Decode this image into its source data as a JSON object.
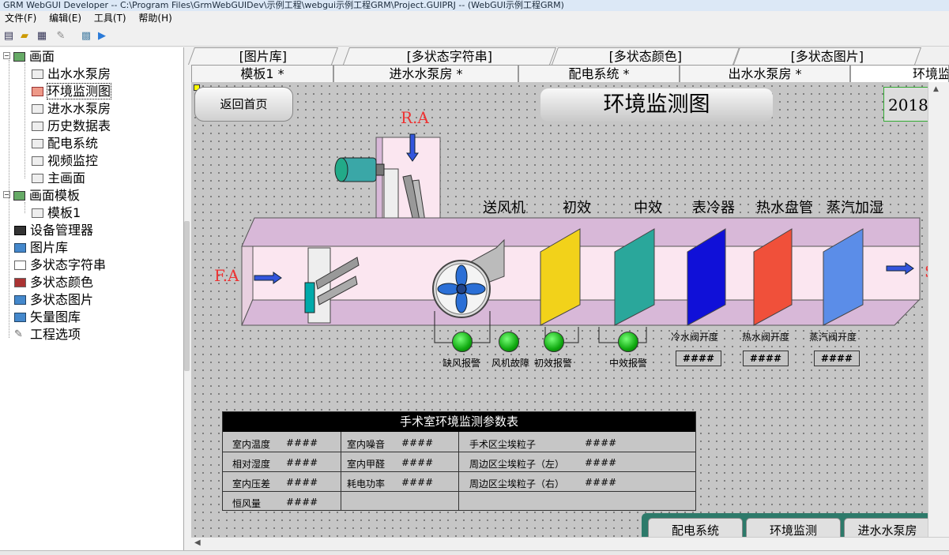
{
  "window": {
    "title": "GRM WebGUI Developer -- C:\\Program Files\\GrmWebGUIDev\\示例工程\\webgui示例工程GRM\\Project.GUIPRJ -- (WebGUI示例工程GRM)"
  },
  "menu": {
    "file": "文件(F)",
    "edit": "编辑(E)",
    "tools": "工具(T)",
    "help": "帮助(H)"
  },
  "tree": {
    "screens": "画面",
    "items": [
      "出水水泵房",
      "环境监测图",
      "进水水泵房",
      "历史数据表",
      "配电系统",
      "视频监控",
      "主画面"
    ],
    "templates": "画面模板",
    "template_items": [
      "模板1"
    ],
    "device_manager": "设备管理器",
    "image_lib": "图片库",
    "multi_string": "多状态字符串",
    "multi_color": "多状态颜色",
    "multi_image": "多状态图片",
    "vector_lib": "矢量图库",
    "project_options": "工程选项"
  },
  "tabs_top": [
    "[图片库]",
    "[多状态字符串]",
    "[多状态颜色]",
    "[多状态图片]"
  ],
  "tabs_bottom": [
    "模板1  *",
    "进水水泵房  *",
    "配电系统  *",
    "出水水泵房  *",
    "环境监测"
  ],
  "canvas": {
    "home_button": "返回首页",
    "title": "环境监测图",
    "date": "2018-",
    "ra": "R.A",
    "fa": "F.A",
    "s": "S",
    "sections": [
      "送风机",
      "初效",
      "中效",
      "表冷器",
      "热水盘管",
      "蒸汽加湿"
    ],
    "valves": [
      "冷水阀开度",
      "热水阀开度",
      "蒸汽阀开度"
    ],
    "valve_values": [
      "####",
      "####",
      "####"
    ],
    "alarms": [
      "缺风报警",
      "风机故障",
      "初效报警",
      "中效报警"
    ],
    "colors": {
      "primary_filter": "#f2d21a",
      "medium_filter": "#2aa79b",
      "cooler": "#1010d8",
      "heater": "#f0503a",
      "humidifier": "#5b8de8",
      "duct": "#d8b8d8",
      "alarm_ok": "#22bb22"
    }
  },
  "param_table": {
    "title": "手术室环境监测参数表",
    "col1": [
      [
        "室内温度",
        "####"
      ],
      [
        "相对湿度",
        "####"
      ],
      [
        "室内压差",
        "####"
      ],
      [
        "恒风量",
        "####"
      ]
    ],
    "col2": [
      [
        "室内噪音",
        "####"
      ],
      [
        "室内甲醛",
        "####"
      ],
      [
        "耗电功率",
        "####"
      ]
    ],
    "col3": [
      [
        "手术区尘埃粒子",
        "####"
      ],
      [
        "周边区尘埃粒子（左）",
        "####"
      ],
      [
        "周边区尘埃粒子（右）",
        "####"
      ]
    ]
  },
  "bottom_tabs": [
    "配电系统",
    "环境监测",
    "进水水泵房"
  ]
}
